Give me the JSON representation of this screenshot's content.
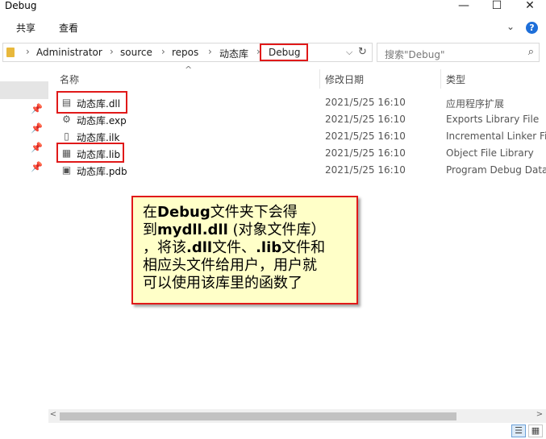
{
  "window": {
    "title": "Debug",
    "min_glyph": "—",
    "max_glyph": "☐",
    "close_glyph": "✕"
  },
  "ribbon": {
    "tabs": [
      "共享",
      "查看"
    ],
    "expand_glyph": "⌄",
    "help_glyph": "?"
  },
  "address": {
    "crumbs": [
      "Administrator",
      "source",
      "repos",
      "动态库",
      "Debug"
    ],
    "sep_glyph": "›",
    "dropdown_glyph": "⌵",
    "refresh_glyph": "↻"
  },
  "search": {
    "placeholder": "搜索\"Debug\"",
    "icon_glyph": "⌕"
  },
  "columns": {
    "name": "名称",
    "date": "修改日期",
    "type": "类型",
    "sort_glyph": "^"
  },
  "files": [
    {
      "name": "动态库.dll",
      "date": "2021/5/25 16:10",
      "type": "应用程序扩展",
      "icon": "dll-file-icon",
      "glyph": "▤"
    },
    {
      "name": "动态库.exp",
      "date": "2021/5/25 16:10",
      "type": "Exports Library File",
      "icon": "exp-file-icon",
      "glyph": "⚙"
    },
    {
      "name": "动态库.ilk",
      "date": "2021/5/25 16:10",
      "type": "Incremental Linker File",
      "icon": "ilk-file-icon",
      "glyph": "▯"
    },
    {
      "name": "动态库.lib",
      "date": "2021/5/25 16:10",
      "type": "Object File Library",
      "icon": "lib-file-icon",
      "glyph": "▦"
    },
    {
      "name": "动态库.pdb",
      "date": "2021/5/25 16:10",
      "type": "Program Debug Database",
      "icon": "pdb-file-icon",
      "glyph": "▣"
    }
  ],
  "nav": {
    "pin_glyph": "📌"
  },
  "note": {
    "line1_a": "在",
    "line1_b": "Debug",
    "line1_c": "文件夹下会得",
    "line2_a": "到",
    "line2_b": "mydll.dll",
    "line2_c": " (对象文件库）",
    "line3_a": "，将该",
    "line3_b": ".dll",
    "line3_c": "文件、",
    "line3_d": ".lib",
    "line3_e": "文件和",
    "line4": "相应头文件给用户，用户就",
    "line5": "可以使用该库里的函数了"
  },
  "scroll": {
    "left_glyph": "<",
    "right_glyph": ">"
  },
  "status": {
    "details_glyph": "☰",
    "tiles_glyph": "▦"
  },
  "colors": {
    "highlight": "#e01919",
    "note_bg": "#ffffc8",
    "accent": "#1e6fd9"
  }
}
